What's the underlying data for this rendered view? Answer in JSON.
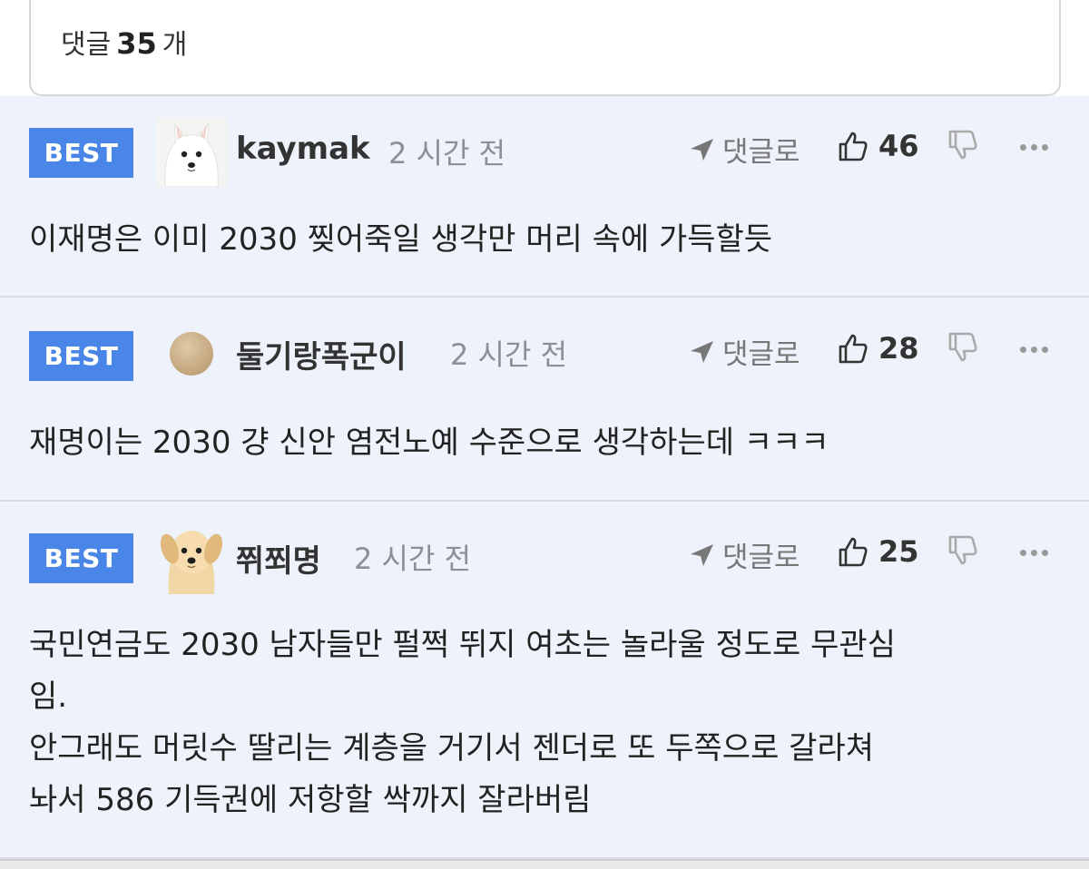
{
  "comment_count": {
    "prefix": "댓글",
    "count": "35",
    "suffix": "개"
  },
  "comments": [
    {
      "badge": "BEST",
      "username": "kaymak",
      "time": "2 시간 전",
      "reply_label": "댓글로",
      "likes": "46",
      "lines": [
        "이재명은 이미 2030 찢어죽일 생각만 머리 속에 가득할듯"
      ]
    },
    {
      "badge": "BEST",
      "username": "둘기랑폭군이",
      "time": "2 시간 전",
      "reply_label": "댓글로",
      "likes": "28",
      "lines": [
        "재명이는 2030 걍 신안 염전노예 수준으로 생각하는데 ㅋㅋㅋ"
      ]
    },
    {
      "badge": "BEST",
      "username": "쮜쬐명",
      "time": "2 시간 전",
      "reply_label": "댓글로",
      "likes": "25",
      "lines": [
        "국민연금도 2030 남자들만 펄쩍 뛰지 여초는 놀라울 정도로 무관심",
        "임.",
        "안그래도 머릿수 딸리는 계층을 거기서 젠더로 또 두쪽으로 갈라쳐",
        "놔서 586 기득권에 저항할 싹까지 잘라버림"
      ]
    }
  ],
  "colors": {
    "best_badge": "#4a86e8",
    "comment_bg": "#eef2fb",
    "muted": "#8a8f99"
  },
  "icons": {
    "reply": "send-arrow-icon",
    "like": "thumbs-up-icon",
    "dislike": "thumbs-down-icon",
    "more": "more-dots-icon"
  }
}
